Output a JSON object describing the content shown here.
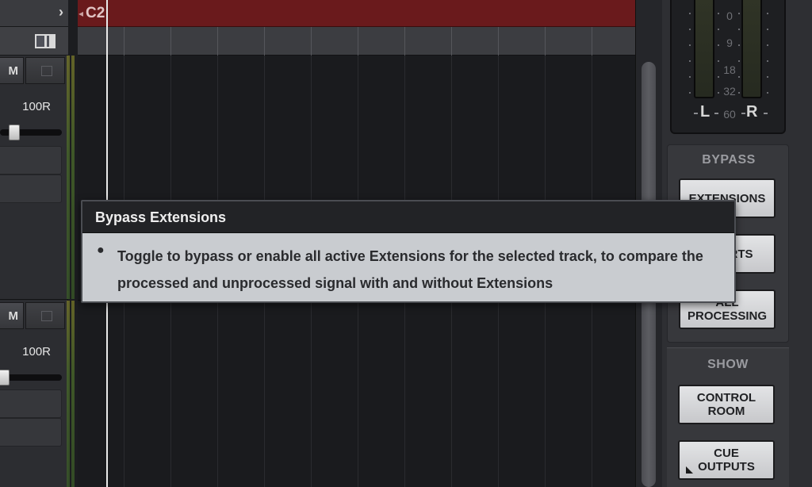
{
  "tracks": [
    {
      "mute_label": "M",
      "pan": "100R",
      "fader_level": 0.2
    },
    {
      "mute_label": "M",
      "pan": "100R",
      "fader_level": 0.0
    }
  ],
  "arrangement": {
    "marker_label": "C2"
  },
  "meter": {
    "scale": [
      "0",
      "9",
      "18",
      "32",
      "60"
    ],
    "left_label": "L",
    "right_label": "R"
  },
  "bypass": {
    "title": "BYPASS",
    "buttons": [
      {
        "line1": "EXTENSIONS",
        "line2": ""
      },
      {
        "line1": "INSERTS",
        "line2": ""
      },
      {
        "line1": "ALL",
        "line2": "PROCESSING"
      }
    ]
  },
  "show": {
    "title": "SHOW",
    "buttons": [
      {
        "line1": "CONTROL",
        "line2": "ROOM"
      },
      {
        "line1": "CUE",
        "line2": "OUTPUTS"
      }
    ]
  },
  "tooltip": {
    "title": "Bypass Extensions",
    "body": "Toggle to bypass or enable all active Extensions for the selected track, to compare the processed and unprocessed signal with and without Extensions"
  },
  "colors": {
    "marker_red": "#6a1a1c",
    "tooltip_bg": "#c9ccd0",
    "tooltip_header": "#222326",
    "button_face": "#d6d7da"
  }
}
